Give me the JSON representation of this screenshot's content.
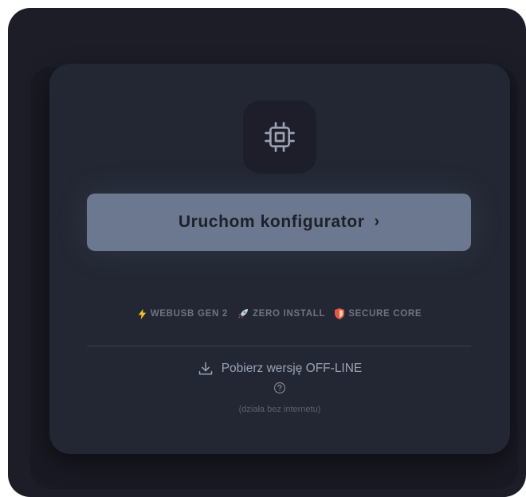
{
  "launch_button": {
    "label": "Uruchom konfigurator",
    "arrow": "›"
  },
  "features": [
    {
      "icon": "lightning-icon",
      "label": "WEBUSB GEN 2"
    },
    {
      "icon": "rocket-icon",
      "label": "ZERO INSTALL"
    },
    {
      "icon": "shield-icon",
      "label": "SECURE CORE"
    }
  ],
  "download": {
    "icon": "download-icon",
    "label": "Pobierz wersję OFF-LINE"
  },
  "help": {
    "icon": "question-circle-icon"
  },
  "note": "(działa bez internetu)",
  "colors": {
    "background": "#1c1d27",
    "card": "#232733",
    "button": "#6c788f",
    "accent_lightning": "#f2c230",
    "accent_shield": "#e2574c"
  }
}
